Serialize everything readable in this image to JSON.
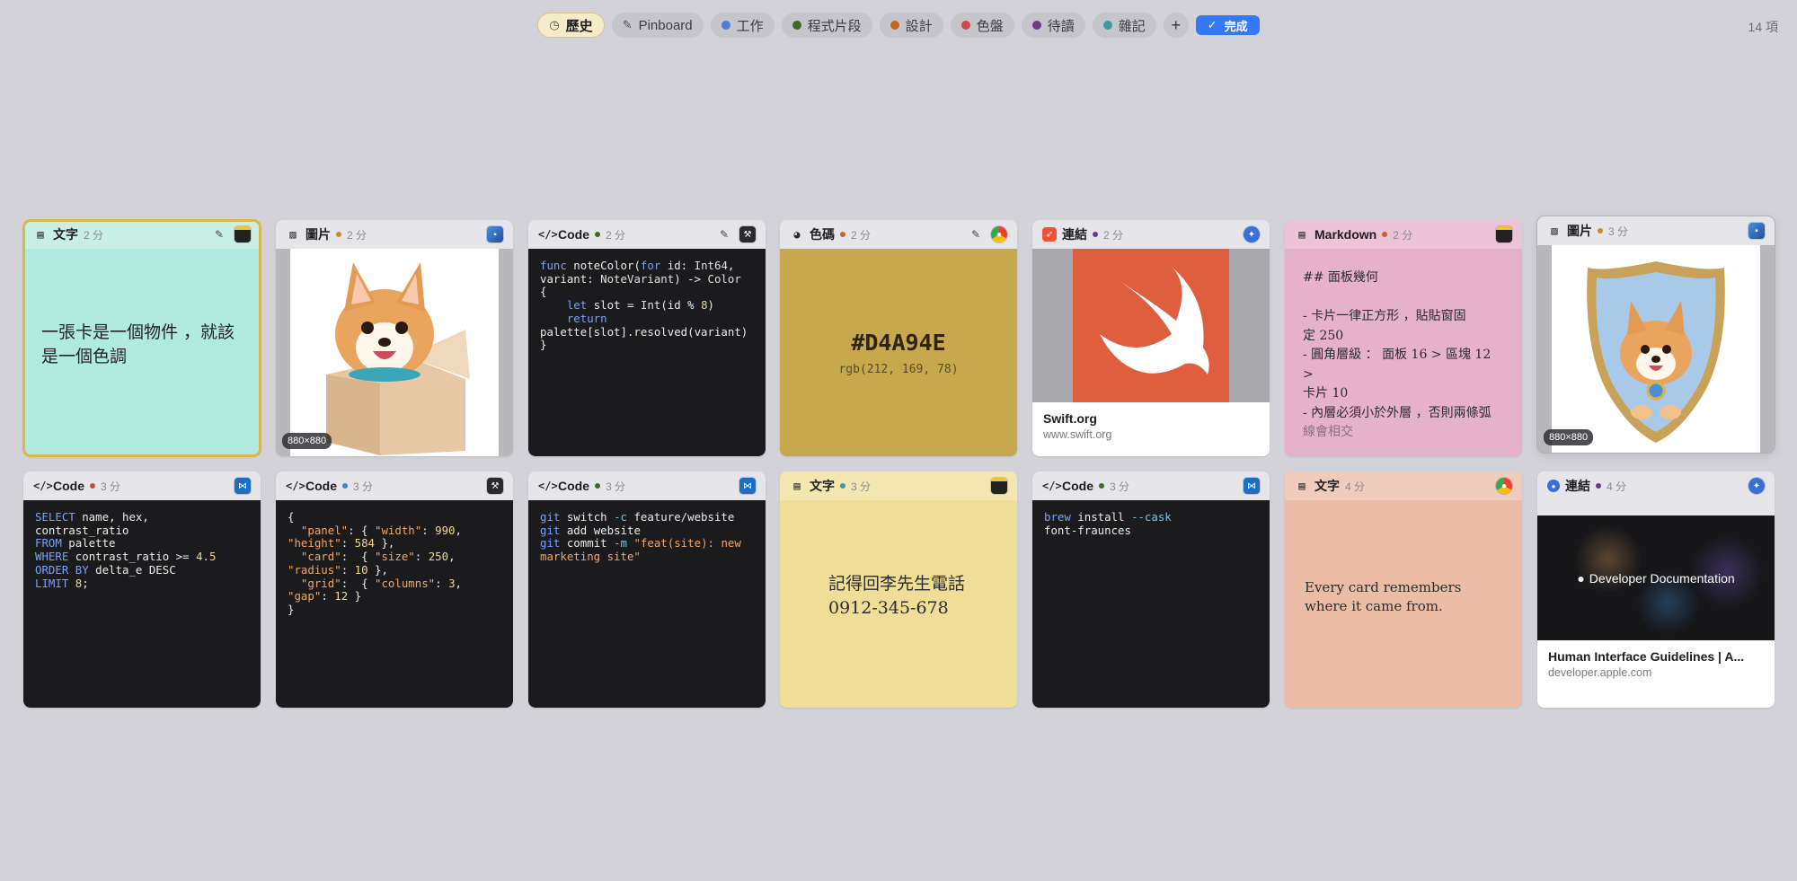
{
  "toolbar": {
    "history": "歷史",
    "pinboard": "Pinboard",
    "tags": [
      {
        "label": "工作",
        "color": "#4a7fd4"
      },
      {
        "label": "程式片段",
        "color": "#3f6b2a"
      },
      {
        "label": "設計",
        "color": "#c06a1a"
      },
      {
        "label": "色盤",
        "color": "#c84a4a"
      },
      {
        "label": "待讀",
        "color": "#6b3a8c"
      },
      {
        "label": "雜記",
        "color": "#3a9c9c"
      }
    ],
    "add": "+",
    "done": "完成",
    "count": "14 項"
  },
  "cards": {
    "c1": {
      "type": "文字",
      "time": "2 分",
      "text": "一張卡是一個物件 ，就該是一個色調"
    },
    "c2": {
      "type": "圖片",
      "time": "2 分",
      "dot": "#c98a2e",
      "badge": "880×880"
    },
    "c3": {
      "type": "Code",
      "time": "2 分",
      "dot": "#3f6b2a"
    },
    "c4": {
      "type": "色碼",
      "time": "2 分",
      "dot": "#c06a1a",
      "hex": "#D4A94E",
      "rgb": "rgb(212, 169, 78)",
      "swatch": "#c8a84e"
    },
    "c5": {
      "type": "連結",
      "time": "2 分",
      "dot": "#6b3a8c",
      "title": "Swift.org",
      "url": "www.swift.org"
    },
    "c6": {
      "type": "Markdown",
      "time": "2 分",
      "dot": "#c06a1a",
      "lines": [
        "## 面板幾何",
        "",
        "- 卡片一律正方形 ，貼貼窗固",
        "定 250",
        "- 圓角層級 ： 面板 16 > 區塊 12 >",
        "卡片 10",
        "- 內層必須小於外層 ，否則兩條弧",
        "線會相交"
      ]
    },
    "c7": {
      "type": "圖片",
      "time": "3 分",
      "dot": "#c98a2e",
      "badge": "880×880"
    },
    "c8": {
      "type": "Code",
      "time": "3 分",
      "dot": "#c84a4a"
    },
    "c9": {
      "type": "Code",
      "time": "3 分",
      "dot": "#4a7fd4"
    },
    "c10": {
      "type": "Code",
      "time": "3 分",
      "dot": "#3f6b2a"
    },
    "c11": {
      "type": "文字",
      "time": "3 分",
      "dot": "#3a9c9c",
      "line1": "記得回李先生電話",
      "line2": "0912-345-678"
    },
    "c12": {
      "type": "Code",
      "time": "3 分",
      "dot": "#3f6b2a"
    },
    "c13": {
      "type": "文字",
      "time": "4 分",
      "text": "Every card remembers where it came from."
    },
    "c14": {
      "type": "連結",
      "time": "4 分",
      "dot": "#6b3a8c",
      "banner": "Developer Documentation",
      "title": "Human Interface Guidelines | A...",
      "url": "developer.apple.com"
    }
  }
}
